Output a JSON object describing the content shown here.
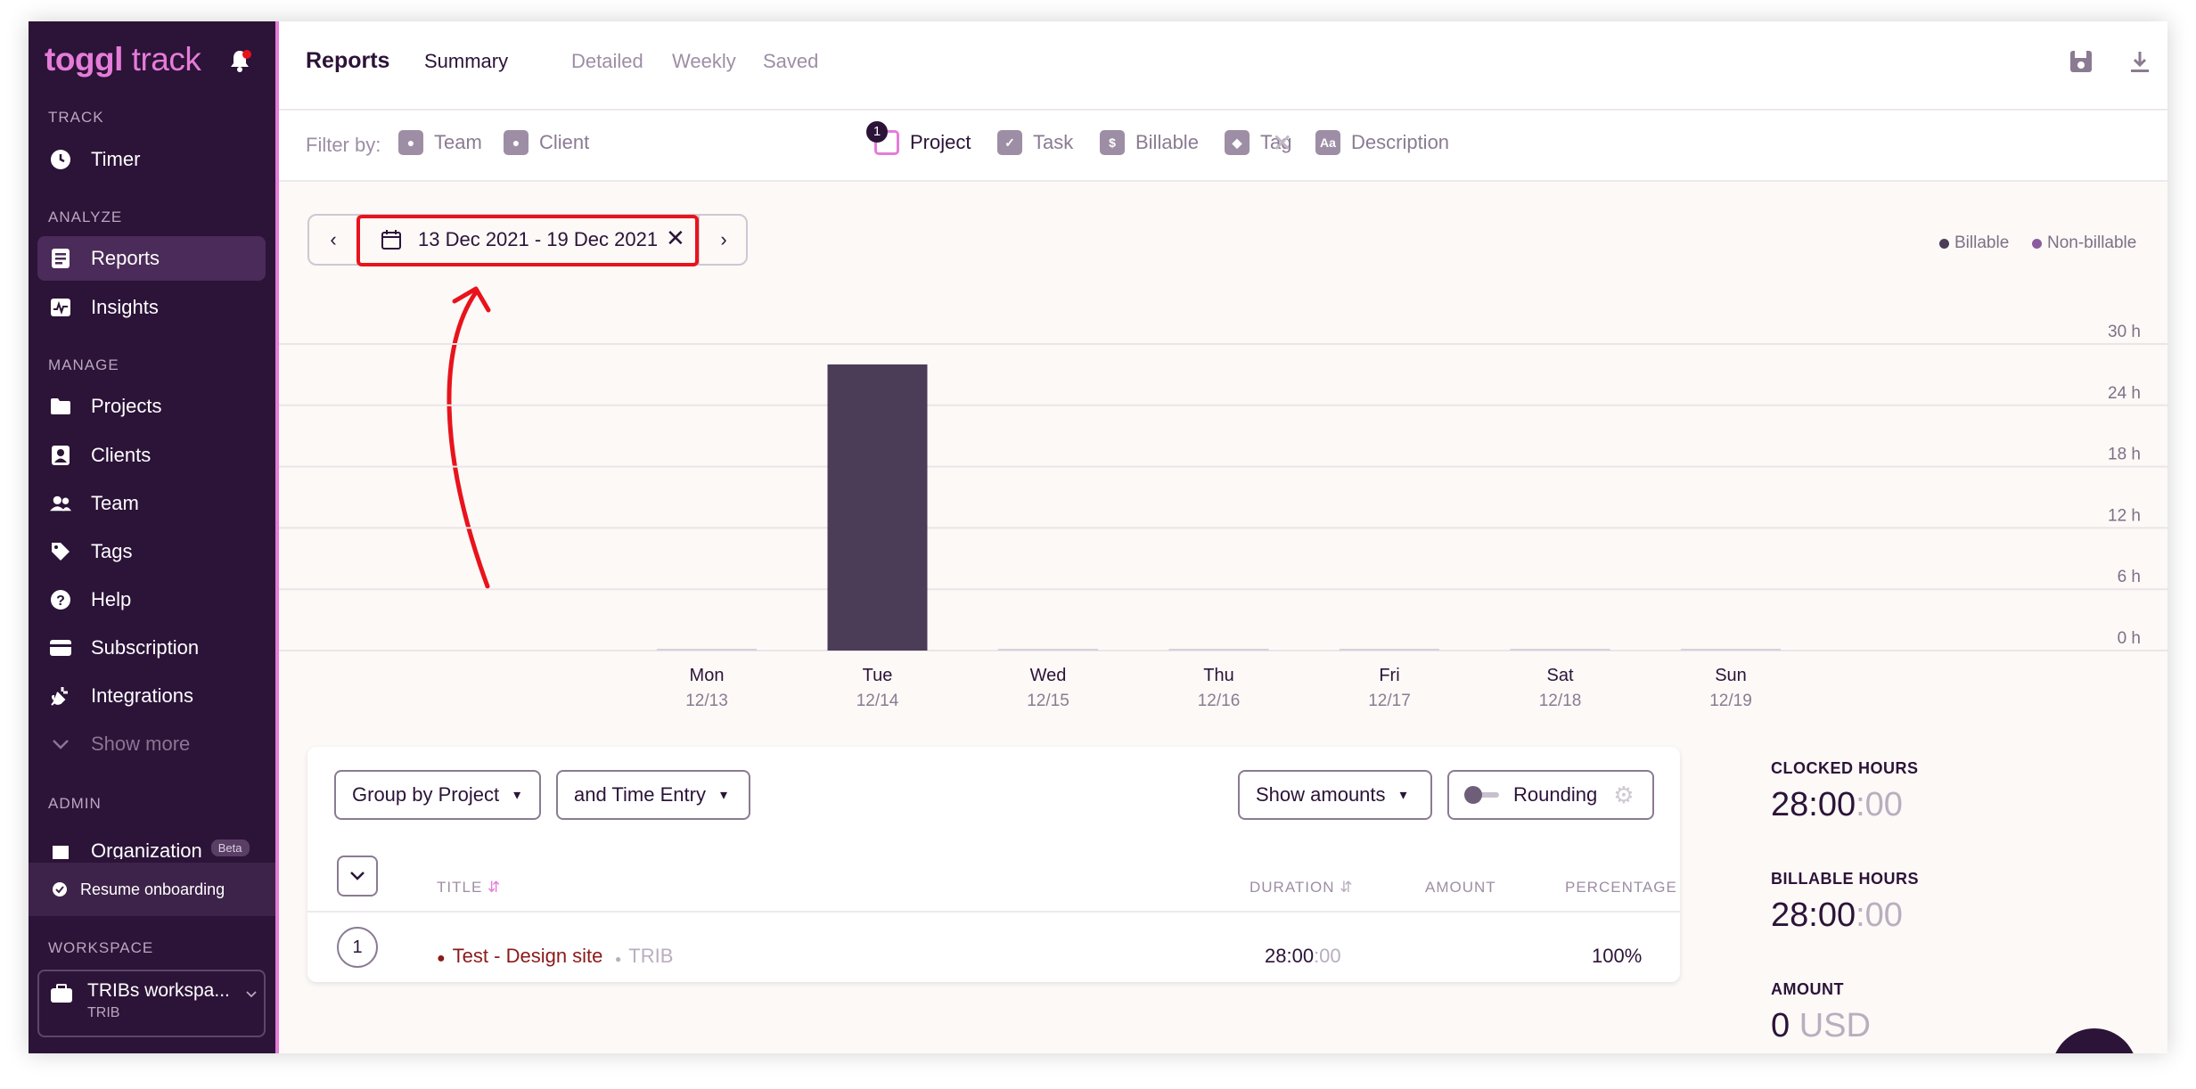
{
  "sidebar": {
    "logo_main": "toggl",
    "logo_sub": " track",
    "sections": {
      "track": "TRACK",
      "analyze": "ANALYZE",
      "manage": "MANAGE",
      "admin": "ADMIN",
      "workspace": "WORKSPACE"
    },
    "items": {
      "timer": "Timer",
      "reports": "Reports",
      "insights": "Insights",
      "projects": "Projects",
      "clients": "Clients",
      "team": "Team",
      "tags": "Tags",
      "help": "Help",
      "subscription": "Subscription",
      "integrations": "Integrations",
      "show_more": "Show more",
      "organization": "Organization",
      "beta": "Beta"
    },
    "onboarding": "Resume onboarding",
    "workspace_name": "TRIBs workspa...",
    "workspace_sub": "TRIB"
  },
  "header": {
    "title": "Reports",
    "tabs": [
      "Summary",
      "Detailed",
      "Weekly",
      "Saved"
    ],
    "active_tab": "Summary"
  },
  "filters": {
    "label": "Filter by:",
    "items": [
      "Team",
      "Client",
      "Project",
      "Task",
      "Billable",
      "Tag",
      "Description"
    ],
    "active": "Project",
    "project_count": "1"
  },
  "date_range": {
    "label": "13 Dec 2021 - 19 Dec 2021"
  },
  "legend": {
    "billable": "Billable",
    "non_billable": "Non-billable"
  },
  "chart_data": {
    "type": "bar",
    "categories": [
      "Mon",
      "Tue",
      "Wed",
      "Thu",
      "Fri",
      "Sat",
      "Sun"
    ],
    "dates": [
      "12/13",
      "12/14",
      "12/15",
      "12/16",
      "12/17",
      "12/18",
      "12/19"
    ],
    "series": [
      {
        "name": "Billable",
        "values": [
          0,
          28,
          0,
          0,
          0,
          0,
          0
        ]
      }
    ],
    "yticks": [
      "0 h",
      "6 h",
      "12 h",
      "18 h",
      "24 h",
      "30 h"
    ],
    "ylim": [
      0,
      30
    ],
    "colors": {
      "bar": "#4b3c58",
      "grid": "#ebe5e8"
    }
  },
  "table": {
    "group_by": "Group by Project",
    "sub_group": "and Time Entry",
    "amounts": "Show amounts",
    "rounding": "Rounding",
    "columns": {
      "title": "TITLE",
      "duration": "DURATION",
      "amount": "AMOUNT",
      "percentage": "PERCENTAGE"
    },
    "rows": [
      {
        "index": "1",
        "project": "Test - Design site",
        "client": "TRIB",
        "duration_main": "28:00",
        "duration_sec": ":00",
        "amount": "",
        "percentage": "100%"
      }
    ]
  },
  "stats": {
    "clocked_label": "CLOCKED HOURS",
    "clocked_main": "28:00",
    "clocked_sec": ":00",
    "billable_label": "BILLABLE HOURS",
    "billable_main": "28:00",
    "billable_sec": ":00",
    "amount_label": "AMOUNT",
    "amount_value": "0",
    "amount_unit": "USD"
  },
  "colors": {
    "sidebar_bg": "#2c1338",
    "accent": "#e57cd8",
    "project_dot": "#8b1a1a",
    "highlight": "#e8131c"
  }
}
